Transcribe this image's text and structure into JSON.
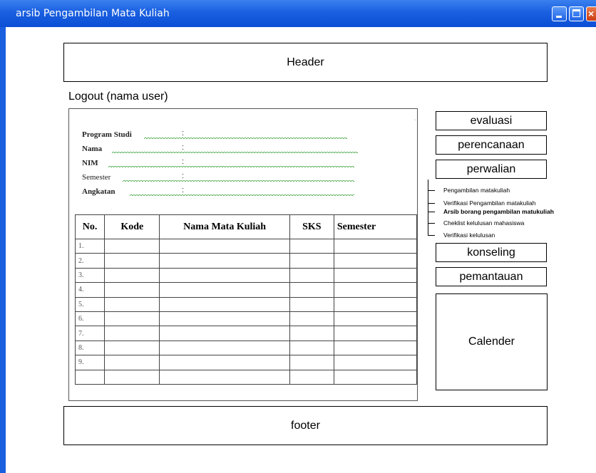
{
  "window": {
    "title": "arsib Pengambilan Mata Kuliah"
  },
  "header": {
    "label": "Header"
  },
  "logout": {
    "label": "Logout (nama user)"
  },
  "form": {
    "program_studi": "Program Studi",
    "nama": "Nama",
    "nim": "NIM",
    "semester": "Semester",
    "angkatan": "Angkatan",
    "colon": ":"
  },
  "table": {
    "headers": [
      "No.",
      "Kode",
      "Nama Mata Kuliah",
      "SKS",
      "Semester"
    ],
    "rows": [
      "1.",
      "2.",
      "3.",
      "4.",
      "5.",
      "6.",
      "7.",
      "8.",
      "9.",
      ""
    ]
  },
  "menu": {
    "evaluasi": "evaluasi",
    "perencanaan": "perencanaan",
    "perwalian": "perwalian",
    "submenu": [
      "Pengambilan matakuliah",
      "Verifikasi Pengambilan matakuliah",
      "Arsib borang pengambilan matukuliah",
      "Cheklist kelulusan mahasiswa",
      "Verifikasi kelulusan"
    ],
    "konseling": "konseling",
    "pemantauan": "pemantauan"
  },
  "calendar": {
    "label": "Calender"
  },
  "footer": {
    "label": "footer"
  }
}
